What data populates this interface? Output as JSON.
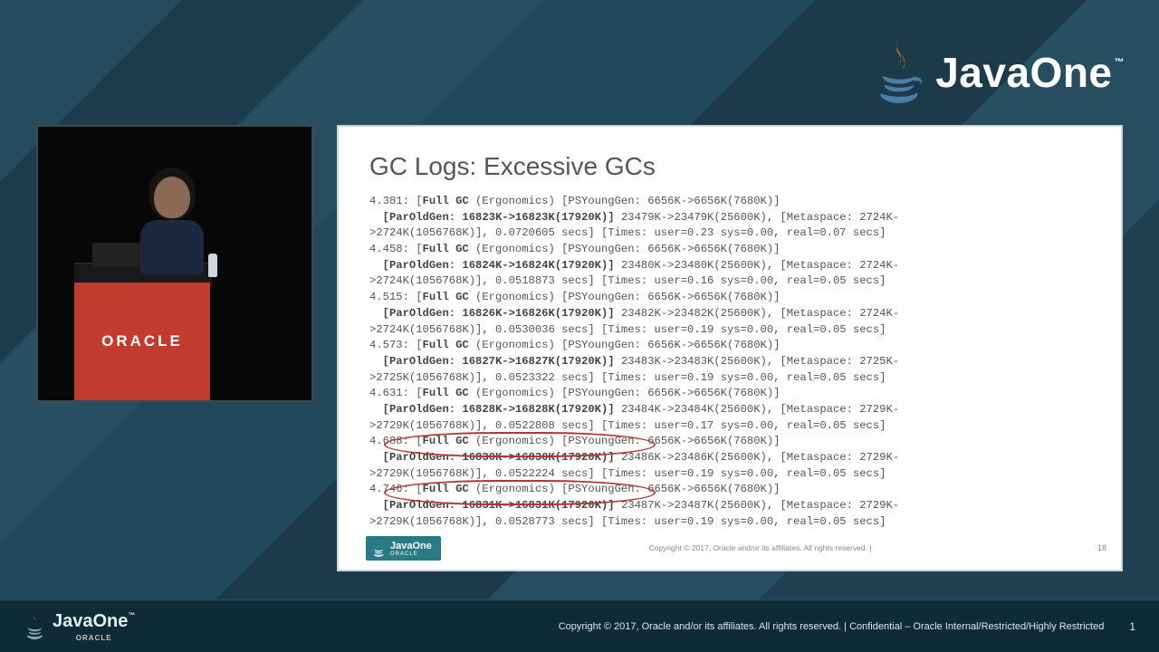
{
  "brand": {
    "top_logo_text": "JavaOne",
    "trademark": "™",
    "oracle": "ORACLE",
    "bottom_logo_text": "JavaOne",
    "podium_text": "ORACLE"
  },
  "slide": {
    "title": "GC Logs: Excessive GCs",
    "entries": [
      {
        "ts": "4.381",
        "young_from": "6656K",
        "young_to": "6656K",
        "young_cap": "7680K",
        "old_from": "16823K",
        "old_to": "16823K",
        "old_cap": "17920K",
        "heap_from": "23479K",
        "heap_to": "23479K",
        "heap_cap": "25600K",
        "meta_from": "2724K",
        "meta_to": "2724K",
        "meta_cap": "1056768K",
        "secs": "0.0720605",
        "user": "0.23",
        "sys": "0.00",
        "real": "0.07"
      },
      {
        "ts": "4.458",
        "young_from": "6656K",
        "young_to": "6656K",
        "young_cap": "7680K",
        "old_from": "16824K",
        "old_to": "16824K",
        "old_cap": "17920K",
        "heap_from": "23480K",
        "heap_to": "23480K",
        "heap_cap": "25600K",
        "meta_from": "2724K",
        "meta_to": "2724K",
        "meta_cap": "1056768K",
        "secs": "0.0518873",
        "user": "0.16",
        "sys": "0.00",
        "real": "0.05"
      },
      {
        "ts": "4.515",
        "young_from": "6656K",
        "young_to": "6656K",
        "young_cap": "7680K",
        "old_from": "16826K",
        "old_to": "16826K",
        "old_cap": "17920K",
        "heap_from": "23482K",
        "heap_to": "23482K",
        "heap_cap": "25600K",
        "meta_from": "2724K",
        "meta_to": "2724K",
        "meta_cap": "1056768K",
        "secs": "0.0530036",
        "user": "0.19",
        "sys": "0.00",
        "real": "0.05"
      },
      {
        "ts": "4.573",
        "young_from": "6656K",
        "young_to": "6656K",
        "young_cap": "7680K",
        "old_from": "16827K",
        "old_to": "16827K",
        "old_cap": "17920K",
        "heap_from": "23483K",
        "heap_to": "23483K",
        "heap_cap": "25600K",
        "meta_from": "2725K",
        "meta_to": "2725K",
        "meta_cap": "1056768K",
        "secs": "0.0523322",
        "user": "0.19",
        "sys": "0.00",
        "real": "0.05"
      },
      {
        "ts": "4.631",
        "young_from": "6656K",
        "young_to": "6656K",
        "young_cap": "7680K",
        "old_from": "16828K",
        "old_to": "16828K",
        "old_cap": "17920K",
        "heap_from": "23484K",
        "heap_to": "23484K",
        "heap_cap": "25600K",
        "meta_from": "2729K",
        "meta_to": "2729K",
        "meta_cap": "1056768K",
        "secs": "0.0522808",
        "user": "0.17",
        "sys": "0.00",
        "real": "0.05"
      },
      {
        "ts": "4.688",
        "young_from": "6656K",
        "young_to": "6656K",
        "young_cap": "7680K",
        "old_from": "16830K",
        "old_to": "16830K",
        "old_cap": "17920K",
        "heap_from": "23486K",
        "heap_to": "23486K",
        "heap_cap": "25600K",
        "meta_from": "2729K",
        "meta_to": "2729K",
        "meta_cap": "1056768K",
        "secs": "0.0522224",
        "user": "0.19",
        "sys": "0.00",
        "real": "0.05"
      },
      {
        "ts": "4.746",
        "young_from": "6656K",
        "young_to": "6656K",
        "young_cap": "7680K",
        "old_from": "16831K",
        "old_to": "16831K",
        "old_cap": "17920K",
        "heap_from": "23487K",
        "heap_to": "23487K",
        "heap_cap": "25600K",
        "meta_from": "2729K",
        "meta_to": "2729K",
        "meta_cap": "1056768K",
        "secs": "0.0528773",
        "user": "0.19",
        "sys": "0.00",
        "real": "0.05"
      }
    ],
    "footer_badge": "JavaOne",
    "footer_copy": "Copyright © 2017, Oracle and/or its affiliates. All rights reserved.  |",
    "page_number": "18"
  },
  "bottom": {
    "legal": "Copyright © 2017, Oracle and/or its affiliates. All rights reserved.   |   Confidential – Oracle Internal/Restricted/Highly Restricted",
    "page": "1"
  }
}
